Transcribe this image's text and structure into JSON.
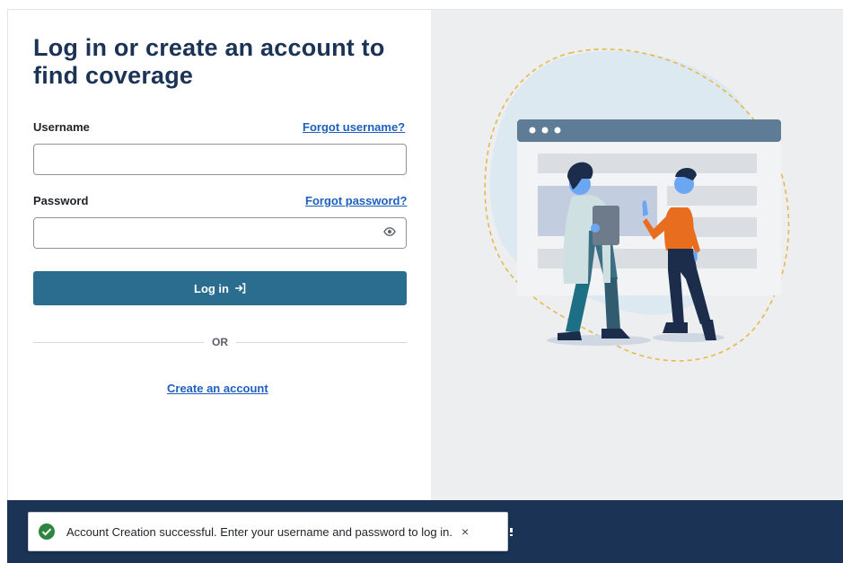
{
  "login": {
    "heading": "Log in or create an account to find coverage",
    "username_label": "Username",
    "forgot_username": "Forgot username?",
    "username_value": "",
    "password_label": "Password",
    "forgot_password": "Forgot password?",
    "password_value": "",
    "login_button": "Log in",
    "divider_text": "OR",
    "create_account": "Create an account"
  },
  "toast": {
    "message": "Account Creation successful. Enter your username and password to log in.",
    "close": "×"
  },
  "colors": {
    "heading": "#1b3354",
    "primary_button": "#2b6d8f",
    "link": "#1f5fbf",
    "footer": "#1b3354",
    "success": "#2e8540"
  },
  "icons": [
    "eye-icon",
    "login-arrow-icon",
    "success-check-icon",
    "close-icon"
  ]
}
